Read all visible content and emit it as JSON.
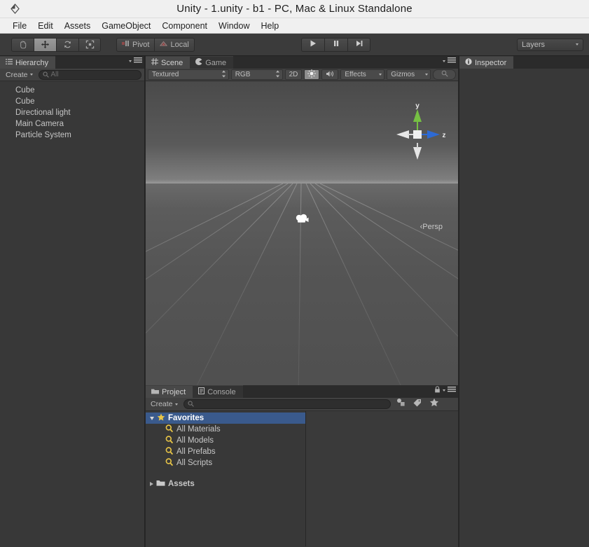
{
  "window": {
    "title": "Unity - 1.unity - b1 - PC, Mac & Linux Standalone",
    "logo_icon": "unity-logo-icon"
  },
  "menubar": {
    "items": [
      {
        "label": "File"
      },
      {
        "label": "Edit"
      },
      {
        "label": "Assets"
      },
      {
        "label": "GameObject"
      },
      {
        "label": "Component"
      },
      {
        "label": "Window"
      },
      {
        "label": "Help"
      }
    ]
  },
  "toolbar": {
    "transform_tools": [
      {
        "name": "hand-tool",
        "icon": "hand-icon",
        "active": false
      },
      {
        "name": "move-tool",
        "icon": "move-arrows-icon",
        "active": true
      },
      {
        "name": "rotate-tool",
        "icon": "rotate-icon",
        "active": false
      },
      {
        "name": "scale-tool",
        "icon": "scale-icon",
        "active": false
      }
    ],
    "pivot_label": "Pivot",
    "local_label": "Local",
    "play_buttons": [
      {
        "name": "play-button",
        "icon": "play-icon"
      },
      {
        "name": "pause-button",
        "icon": "pause-icon"
      },
      {
        "name": "step-button",
        "icon": "step-icon"
      }
    ],
    "layers_label": "Layers"
  },
  "hierarchy": {
    "tab_label": "Hierarchy",
    "tab_icon": "hierarchy-icon",
    "create_label": "Create",
    "search_placeholder": "All",
    "items": [
      {
        "label": "Cube"
      },
      {
        "label": "Cube"
      },
      {
        "label": "Directional light"
      },
      {
        "label": "Main Camera"
      },
      {
        "label": "Particle System"
      }
    ]
  },
  "scene": {
    "tabs": [
      {
        "label": "Scene",
        "icon": "scene-grid-icon",
        "active": true
      },
      {
        "label": "Game",
        "icon": "game-pacman-icon",
        "active": false
      }
    ],
    "toolbar": {
      "draw_mode": "Textured",
      "color_mode": "RGB",
      "twod_label": "2D",
      "lighting_icon": "sun-icon",
      "lighting_on": true,
      "audio_icon": "speaker-icon",
      "effects_label": "Effects",
      "gizmos_label": "Gizmos",
      "search_icon": "search-icon"
    },
    "gizmo": {
      "y_label": "y",
      "z_label": "z",
      "y_color": "#76c043",
      "z_color": "#2d6ad4",
      "perspective_label": "Persp"
    },
    "camera_gizmo_icon": "camera-icon"
  },
  "project": {
    "tabs": [
      {
        "label": "Project",
        "icon": "folder-icon",
        "active": true
      },
      {
        "label": "Console",
        "icon": "console-icon",
        "active": false
      }
    ],
    "create_label": "Create",
    "search_placeholder": "",
    "toolbar_icons": [
      {
        "name": "filter-type-icon"
      },
      {
        "name": "filter-label-icon"
      },
      {
        "name": "filter-favorite-icon"
      }
    ],
    "tree": [
      {
        "label": "Favorites",
        "icon": "star-icon",
        "selected": true,
        "expanded": true,
        "level": 0
      },
      {
        "label": "All Materials",
        "icon": "search-magnifier-icon",
        "selected": false,
        "level": 1
      },
      {
        "label": "All Models",
        "icon": "search-magnifier-icon",
        "selected": false,
        "level": 1
      },
      {
        "label": "All Prefabs",
        "icon": "search-magnifier-icon",
        "selected": false,
        "level": 1
      },
      {
        "label": "All Scripts",
        "icon": "search-magnifier-icon",
        "selected": false,
        "level": 1
      },
      {
        "label": "Assets",
        "icon": "folder-icon",
        "selected": false,
        "expanded": false,
        "level": 0
      }
    ]
  },
  "inspector": {
    "tab_label": "Inspector",
    "tab_icon": "info-icon"
  },
  "colors": {
    "accent_selection": "#3a5a8c",
    "favorites_yellow": "#e8c547",
    "axis_y_green": "#76c043",
    "axis_z_blue": "#2d6ad4",
    "panel_bg": "#383838",
    "toolbar_bg": "#3b3b3b",
    "titlebar_bg": "#f0f0f0"
  }
}
